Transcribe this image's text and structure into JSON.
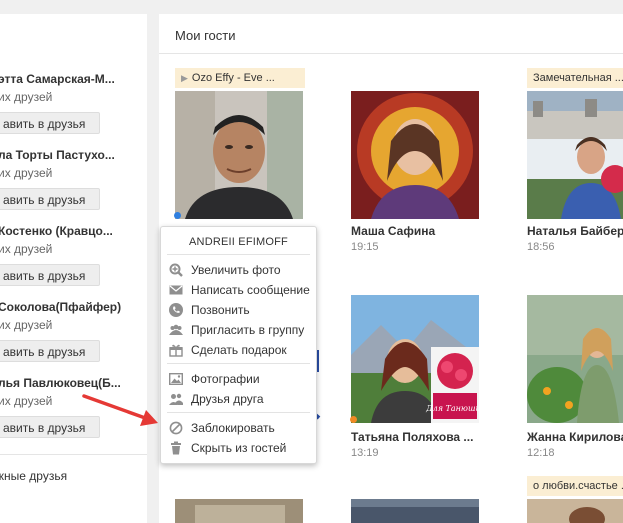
{
  "left_panel": {
    "friends": [
      {
        "name": "этта Самарская-М...",
        "sub": "их друзей",
        "button": "авить в друзья"
      },
      {
        "name": "ла Торты Пастухо...",
        "sub": "их друзей",
        "button": "авить в друзья"
      },
      {
        "name": "Костенко (Кравцо...",
        "sub": "их друзей",
        "button": "авить в друзья"
      },
      {
        "name": "Соколова(Пфайфер)",
        "sub": "их друзей",
        "button": "авить в друзья"
      },
      {
        "name": "лья Павлюковец(Б...",
        "sub": "их друзей",
        "button": "авить в друзья"
      }
    ],
    "footer": "жные друзья"
  },
  "main": {
    "title": "Мои гости",
    "guests": [
      {
        "tag": "Ozo Effy - Eve ...",
        "name": "",
        "time": "",
        "dot_color": "#2f7fe0"
      },
      {
        "tag": "",
        "name": "Маша Сафина",
        "time": "19:15",
        "dot_color": ""
      },
      {
        "tag": "Замечательная ...",
        "name": "Наталья Байбер",
        "time": "18:56",
        "dot_color": ""
      },
      {
        "tag": "",
        "name": "",
        "time": "",
        "dot_color": ""
      },
      {
        "tag": "",
        "name": "Татьяна Поляхова ...",
        "time": "13:19",
        "dot_color": "#f08a24"
      },
      {
        "tag": "",
        "name": "Жанна Кирилова",
        "time": "12:18",
        "dot_color": ""
      },
      {
        "tag": "",
        "name": "",
        "time": "",
        "dot_color": ""
      },
      {
        "tag": "",
        "name": "",
        "time": "",
        "dot_color": ""
      },
      {
        "tag": "о любви.счастье ...",
        "name": "",
        "time": "",
        "dot_color": ""
      }
    ],
    "photo_caption": "Для Танюши!"
  },
  "popup": {
    "title": "ANDREII EFIMOFF",
    "items": [
      {
        "label": "Увеличить фото",
        "icon": "zoom-icon"
      },
      {
        "label": "Написать сообщение",
        "icon": "envelope-icon"
      },
      {
        "label": "Позвонить",
        "icon": "phone-icon"
      },
      {
        "label": "Пригласить в группу",
        "icon": "group-icon"
      },
      {
        "label": "Сделать подарок",
        "icon": "gift-icon"
      },
      {
        "label": "Фотографии",
        "icon": "photo-icon"
      },
      {
        "label": "Друзья друга",
        "icon": "friends-icon"
      },
      {
        "label": "Заблокировать",
        "icon": "block-icon"
      },
      {
        "label": "Скрыть из гостей",
        "icon": "trash-icon"
      }
    ]
  },
  "colors": {
    "tag_bg": "#fbeed3",
    "arrow": "#e53935",
    "icon_gray": "#8f8f8f"
  }
}
